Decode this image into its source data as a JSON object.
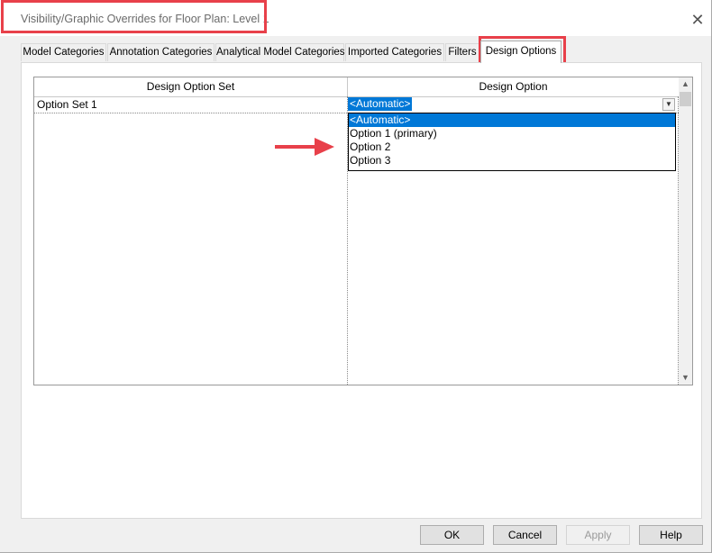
{
  "window": {
    "title": "Visibility/Graphic Overrides for Floor Plan: Level 1",
    "close_glyph": "✕"
  },
  "tabs": [
    {
      "label": "Model Categories",
      "active": false
    },
    {
      "label": "Annotation Categories",
      "active": false
    },
    {
      "label": "Analytical Model Categories",
      "active": false
    },
    {
      "label": "Imported Categories",
      "active": false
    },
    {
      "label": "Filters",
      "active": false
    },
    {
      "label": "Design Options",
      "active": true
    }
  ],
  "grid": {
    "columns": [
      "Design Option Set",
      "Design Option"
    ],
    "rows": [
      {
        "set": "Option Set 1",
        "option": "<Automatic>"
      }
    ]
  },
  "dropdown": {
    "open": true,
    "options": [
      "<Automatic>",
      "Option 1 (primary)",
      "Option 2",
      "Option 3"
    ],
    "selected": "<Automatic>"
  },
  "buttons": {
    "ok": "OK",
    "cancel": "Cancel",
    "apply": "Apply",
    "help": "Help"
  },
  "colors": {
    "accent": "#0078d7",
    "annotation": "#e8404a"
  },
  "icons": {
    "close": "close-icon",
    "dropdown": "chevron-down-icon",
    "scroll_up": "scroll-up-icon",
    "scroll_down": "scroll-down-icon",
    "annotation_arrow": "arrow-right-icon"
  }
}
